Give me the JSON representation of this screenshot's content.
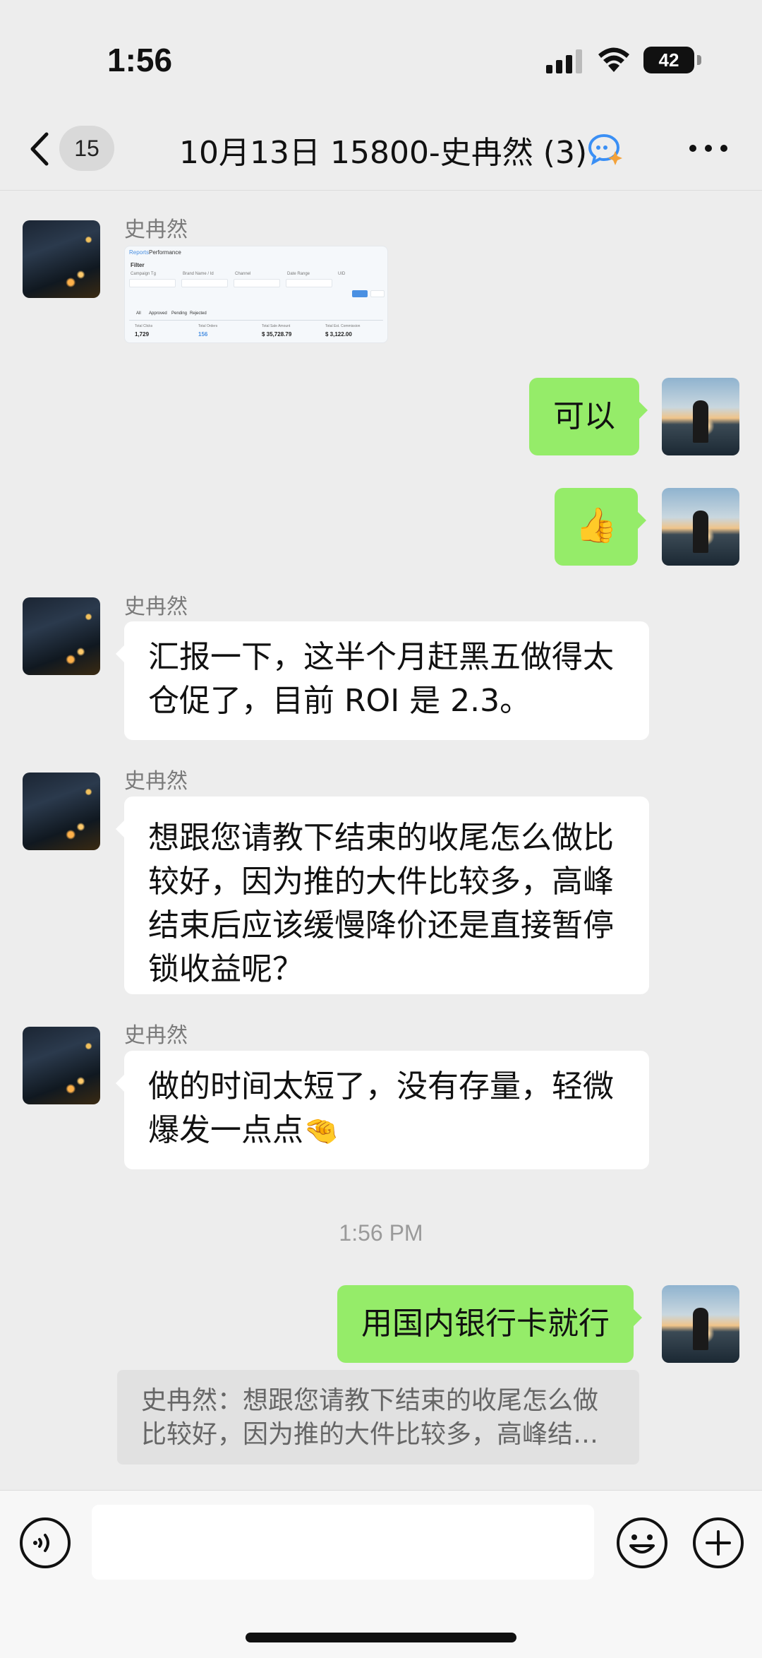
{
  "status_bar": {
    "time": "1:56",
    "battery_level": "42",
    "battery_fraction": 0.42
  },
  "nav": {
    "unread_count": "15",
    "title": "10月13日 15800-史冉然 (3)"
  },
  "messages": [
    {
      "sender": "史冉然",
      "type": "image",
      "side": "left"
    },
    {
      "side": "right",
      "text": "可以"
    },
    {
      "side": "right",
      "type": "emoji",
      "icon": "thumbs-up-icon"
    },
    {
      "sender": "史冉然",
      "side": "left",
      "lines": [
        "汇报一下，这半个月赶黑五做得太",
        "仓促了，目前 ROI 是 2.3。"
      ]
    },
    {
      "sender": "史冉然",
      "side": "left",
      "lines": [
        "想跟您请教下结束的收尾怎么做比",
        "较好，因为推的大件比较多，高峰",
        "结束后应该缓慢降价还是直接暂停",
        "锁收益呢？"
      ]
    },
    {
      "sender": "史冉然",
      "side": "left",
      "lines": [
        "做的时间太短了，没有存量，轻微",
        "爆发一点点"
      ],
      "trailing_icon": "pinching-hand-icon"
    },
    {
      "side": "right",
      "text": "用国内银行卡就行"
    }
  ],
  "time_divider": "1:56 PM",
  "quote": {
    "lines": [
      "史冉然：想跟您请教下结束的收尾怎么做",
      "比较好，因为推的大件比较多，高峰结…"
    ]
  },
  "screenshot_card": {
    "tabs": [
      "Reports",
      "Performance"
    ],
    "filter_label": "Filter",
    "fields": [
      "Campaign Tg",
      "Brand Name / Id",
      "Channel",
      "Date Range",
      "UID"
    ],
    "stat_tabs": [
      "All",
      "Approved",
      "Pending",
      "Rejected"
    ],
    "stats": [
      {
        "label": "Total Clicks",
        "value": "1,729"
      },
      {
        "label": "Total Orders",
        "value": "156"
      },
      {
        "label": "Total Sale Amount",
        "value": "$ 35,728.79"
      },
      {
        "label": "Total Est. Commission",
        "value": "$ 3,122.00"
      }
    ]
  },
  "input": {
    "placeholder": ""
  },
  "colors": {
    "chat_bg": "#ededed",
    "bubble_green": "#95ec69",
    "bubble_white": "#ffffff",
    "quote_bg": "#e1e1e1"
  }
}
